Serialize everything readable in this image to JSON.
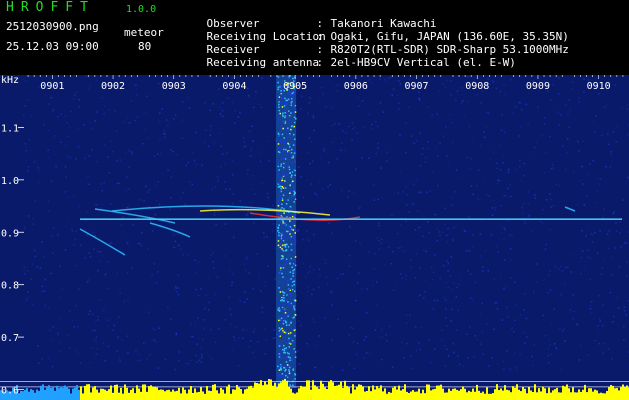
{
  "header": {
    "title": "HROFFT",
    "version": "1.0.0",
    "filename": "2512030900.png",
    "datetime": "25.12.03 09:00",
    "meteor_label": "meteor",
    "meteor_count": "80"
  },
  "info": [
    {
      "label": "Observer",
      "value": "Takanori Kawachi"
    },
    {
      "label": "Receiving Location",
      "value": "Ogaki, Gifu, JAPAN (136.60E, 35.35N)"
    },
    {
      "label": "Receiver",
      "value": "R820T2(RTL-SDR) SDR-Sharp 53.1000MHz"
    },
    {
      "label": "Receiving antenna",
      "value": "2el-HB9CV Vertical (el. E-W)"
    }
  ],
  "chart_data": {
    "type": "heatmap",
    "y_axis_unit": "kHz",
    "x_ticks": [
      "0901",
      "0902",
      "0903",
      "0904",
      "0905",
      "0906",
      "0907",
      "0908",
      "0909",
      "0910"
    ],
    "y_ticks": [
      "1.1",
      "1.0",
      "0.9",
      "0.8",
      "0.7",
      "0.6"
    ],
    "x_range": [
      0,
      10
    ],
    "y_range": [
      0.58,
      1.2
    ],
    "carrier_freq_khz": 0.925,
    "interference_band_minute": 0.35,
    "colors": {
      "background": "#0a1a6a",
      "noise": "#1a3ad0",
      "signal_low": "#30c0ff",
      "signal_mid": "#ffff30",
      "signal_high": "#ff3030",
      "baseline": "#ffff00",
      "grid_text": "#ffffff"
    }
  }
}
